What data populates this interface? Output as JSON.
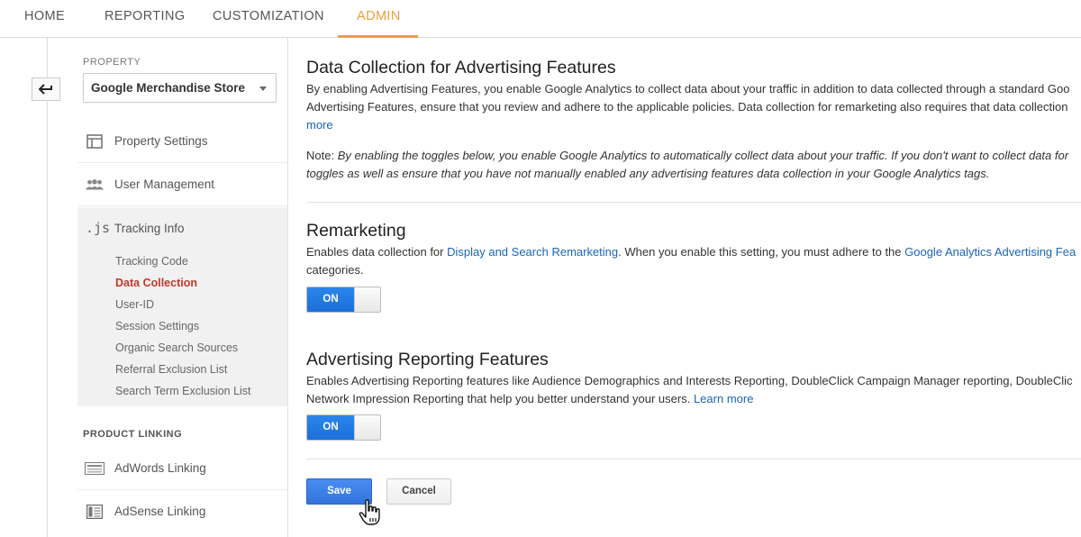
{
  "topnav": {
    "tabs": [
      {
        "label": "HOME"
      },
      {
        "label": "REPORTING"
      },
      {
        "label": "CUSTOMIZATION"
      },
      {
        "label": "ADMIN"
      }
    ],
    "active_tab": "ADMIN",
    "accent_color": "#e8a23a"
  },
  "sidebar": {
    "property_label": "PROPERTY",
    "property_value": "Google Merchandise Store",
    "items": [
      {
        "label": "Property Settings",
        "icon": "window-icon"
      },
      {
        "label": "User Management",
        "icon": "people-icon"
      },
      {
        "label": "Tracking Info",
        "icon": "js-icon"
      }
    ],
    "tracking_sub": [
      {
        "label": "Tracking Code"
      },
      {
        "label": "Data Collection"
      },
      {
        "label": "User-ID"
      },
      {
        "label": "Session Settings"
      },
      {
        "label": "Organic Search Sources"
      },
      {
        "label": "Referral Exclusion List"
      },
      {
        "label": "Search Term Exclusion List"
      }
    ],
    "active_sub": "Data Collection",
    "product_linking_label": "PRODUCT LINKING",
    "linking_items": [
      {
        "label": "AdWords Linking",
        "icon": "adwords-icon"
      },
      {
        "label": "AdSense Linking",
        "icon": "adsense-icon"
      }
    ]
  },
  "main": {
    "title": "Data Collection for Advertising Features",
    "intro_line1": "By enabling Advertising Features, you enable Google Analytics to collect data about your traffic in addition to data collected through a standard Goo",
    "intro_line2": "Advertising Features, ensure that you review and adhere to the applicable policies. Data collection for remarketing also requires that data collection",
    "intro_more": "more",
    "note_prefix": "Note: ",
    "note_line1": "By enabling the toggles below, you enable Google Analytics to automatically collect data about your traffic. If you don't want to collect data for",
    "note_line2": "toggles as well as ensure that you have not manually enabled any advertising features data collection in your Google Analytics tags.",
    "remarketing": {
      "title": "Remarketing",
      "text_a": "Enables data collection for ",
      "link_a": "Display and Search Remarketing",
      "text_b": ". When you enable this setting, you must adhere to the ",
      "link_b": "Google Analytics Advertising Fea",
      "line2": "categories.",
      "toggle": "ON"
    },
    "advertising": {
      "title": "Advertising Reporting Features",
      "line1": "Enables Advertising Reporting features like Audience Demographics and Interests Reporting, DoubleClick Campaign Manager reporting, DoubleClic",
      "line2_text": "Network Impression Reporting that help you better understand your users. ",
      "learn_more": "Learn more",
      "toggle": "ON"
    },
    "save_label": "Save",
    "cancel_label": "Cancel"
  }
}
